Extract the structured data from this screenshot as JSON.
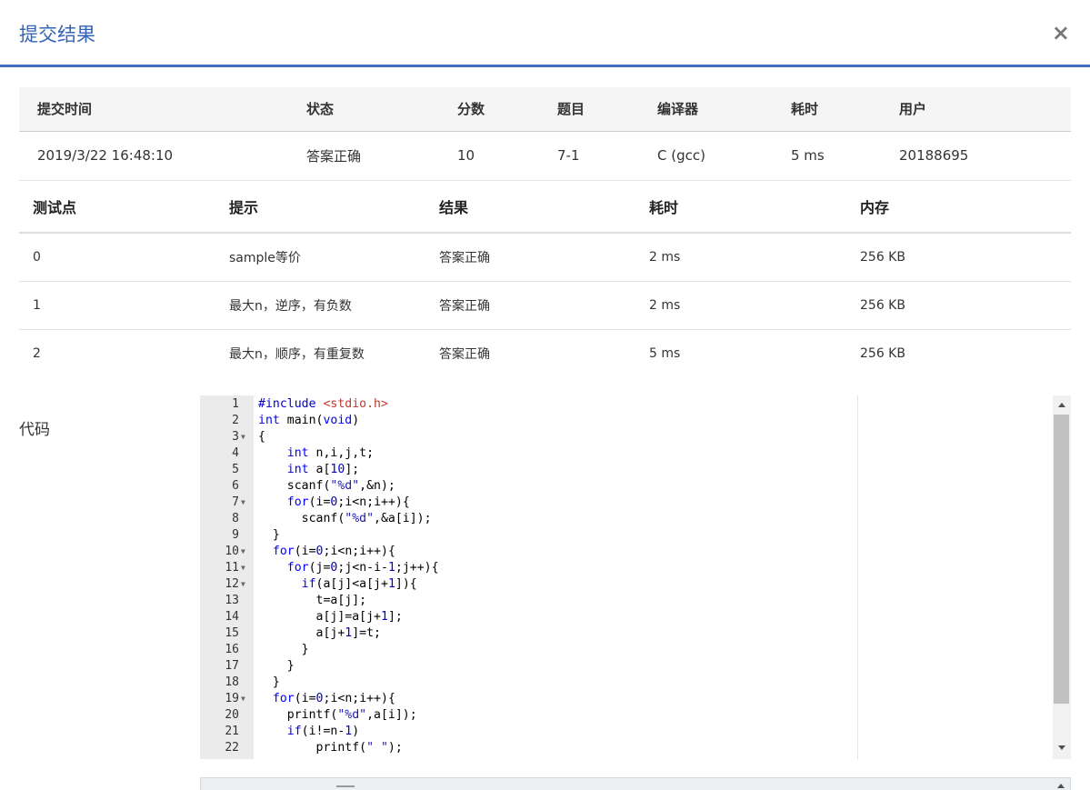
{
  "modal": {
    "title": "提交结果",
    "close": "×"
  },
  "summary": {
    "headers": [
      "提交时间",
      "状态",
      "分数",
      "题目",
      "编译器",
      "耗时",
      "用户"
    ],
    "row": [
      "2019/3/22 16:48:10",
      "答案正确",
      "10",
      "7-1",
      "C (gcc)",
      "5 ms",
      "20188695"
    ]
  },
  "cases": {
    "headers": [
      "测试点",
      "提示",
      "结果",
      "耗时",
      "内存"
    ],
    "rows": [
      [
        "0",
        "sample等价",
        "答案正确",
        "2 ms",
        "256 KB"
      ],
      [
        "1",
        "最大n，逆序，有负数",
        "答案正确",
        "2 ms",
        "256 KB"
      ],
      [
        "2",
        "最大n，顺序，有重复数",
        "答案正确",
        "5 ms",
        "256 KB"
      ]
    ]
  },
  "code": {
    "label": "代码",
    "lines": [
      {
        "n": "1",
        "fold": false,
        "text": "#include <stdio.h>"
      },
      {
        "n": "2",
        "fold": false,
        "text": "int main(void)"
      },
      {
        "n": "3",
        "fold": true,
        "text": "{"
      },
      {
        "n": "4",
        "fold": false,
        "text": "    int n,i,j,t;"
      },
      {
        "n": "5",
        "fold": false,
        "text": "    int a[10];"
      },
      {
        "n": "6",
        "fold": false,
        "text": "    scanf(\"%d\",&n);"
      },
      {
        "n": "7",
        "fold": true,
        "text": "    for(i=0;i<n;i++){"
      },
      {
        "n": "8",
        "fold": false,
        "text": "      scanf(\"%d\",&a[i]);"
      },
      {
        "n": "9",
        "fold": false,
        "text": "  }"
      },
      {
        "n": "10",
        "fold": true,
        "text": "  for(i=0;i<n;i++){"
      },
      {
        "n": "11",
        "fold": true,
        "text": "    for(j=0;j<n-i-1;j++){"
      },
      {
        "n": "12",
        "fold": true,
        "text": "      if(a[j]<a[j+1]){"
      },
      {
        "n": "13",
        "fold": false,
        "text": "        t=a[j];"
      },
      {
        "n": "14",
        "fold": false,
        "text": "        a[j]=a[j+1];"
      },
      {
        "n": "15",
        "fold": false,
        "text": "        a[j+1]=t;"
      },
      {
        "n": "16",
        "fold": false,
        "text": "      }"
      },
      {
        "n": "17",
        "fold": false,
        "text": "    }"
      },
      {
        "n": "18",
        "fold": false,
        "text": "  }"
      },
      {
        "n": "19",
        "fold": true,
        "text": "  for(i=0;i<n;i++){"
      },
      {
        "n": "20",
        "fold": false,
        "text": "    printf(\"%d\",a[i]);"
      },
      {
        "n": "21",
        "fold": false,
        "text": "    if(i!=n-1)"
      },
      {
        "n": "22",
        "fold": false,
        "text": "        printf(\" \");"
      }
    ]
  },
  "colors": {
    "accent": "#3465b5",
    "success": "#e4462f",
    "link": "#2f62b5"
  }
}
